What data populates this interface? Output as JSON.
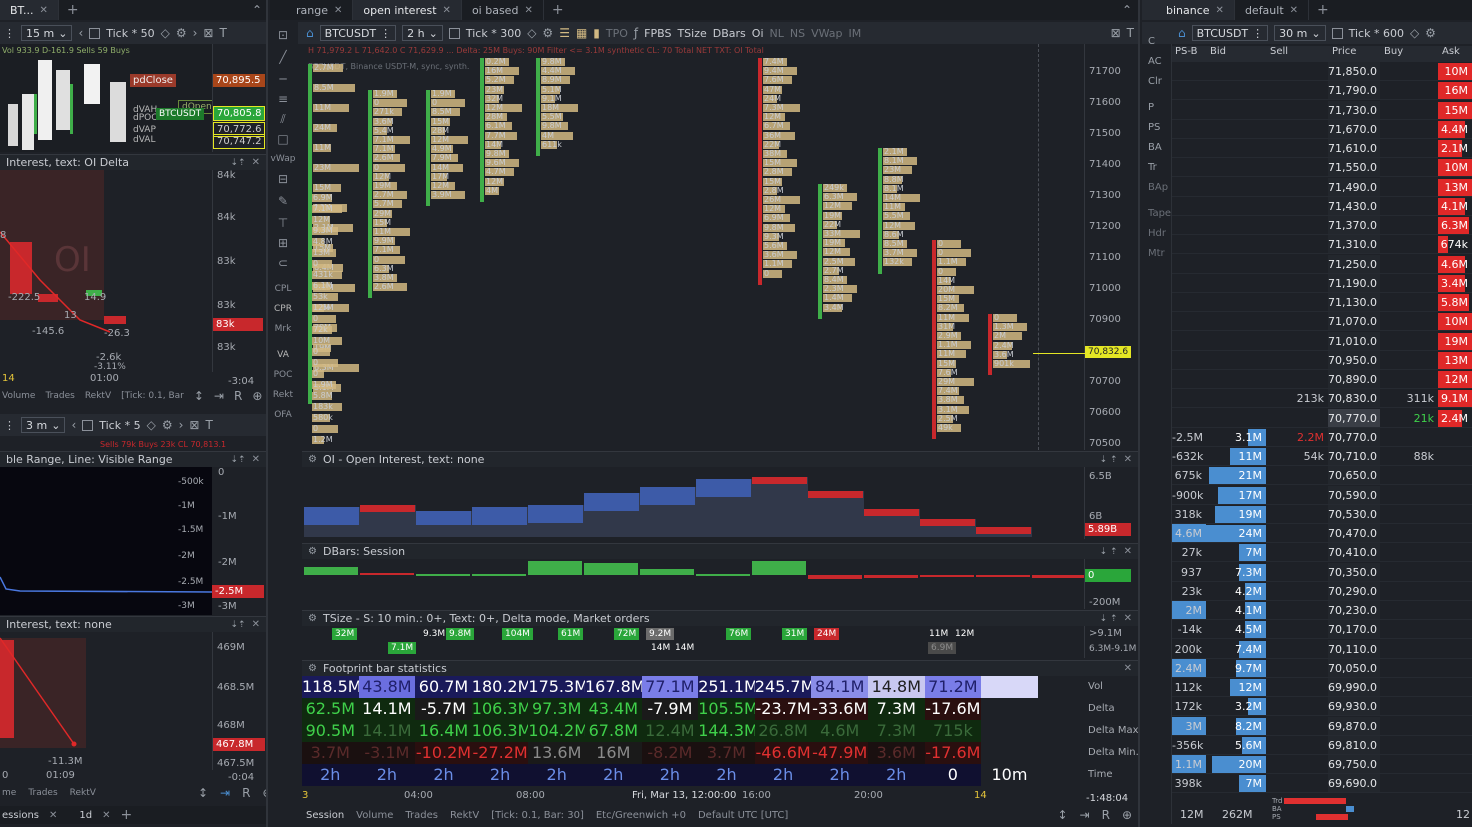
{
  "tabs_left": {
    "first": "BT...",
    "first_close": "✕"
  },
  "tabs_center": [
    {
      "label": "range"
    },
    {
      "label": "open interest"
    },
    {
      "label": "oi based"
    }
  ],
  "tabs_right": [
    {
      "label": "binance"
    },
    {
      "label": "default"
    }
  ],
  "tab_close": "✕",
  "tab_add": "+",
  "left_top": {
    "sym": "⋮",
    "tf": "15 m",
    "tick": "Tick * 50",
    "title": "Interest, text: OI Delta",
    "info": "Vol 933.9 D-161.9 Sells 59 Buys",
    "vlabel_pdclose": "pdClose",
    "price_tag1": "70,895.5",
    "price_tag2": "70,805.8",
    "price_tag3": "70,772.6",
    "price_tag4": "70,747.2",
    "sym_tag": "BTCUSDT",
    "dvah": "dVAH",
    "dpoc": "dPOC",
    "dvap": "dVAP",
    "dval": "dVAL",
    "oopen": "dOpen",
    "axis": [
      "84k",
      "84k",
      "83k",
      "83k",
      "83k"
    ],
    "axis_tag": "83k",
    "vals": [
      "-222.5",
      "14.9",
      "13",
      "-145.6",
      "-26.3",
      "-2.6k",
      "-3.11%"
    ],
    "left_edge": "8",
    "t1": "14",
    "t2": "01:00",
    "t3": "-3:04",
    "bottom": [
      "Volume",
      "Trades",
      "RektV",
      "[Tick: 0.1, Bar"
    ],
    "big": "OI"
  },
  "left_mid": {
    "tf": "3 m",
    "tick": "Tick * 5",
    "title": "ble Range, Line: Visible Range",
    "info": "Sells 79k Buys 23k CL 70,813.1",
    "axis": [
      "0",
      "-500k",
      "-1M",
      "-1M",
      "-1.5M",
      "-2M",
      "-2M",
      "-2.5M",
      "-3M",
      "-3M"
    ],
    "axis_tag": "-2.5M"
  },
  "left_bot": {
    "title": "Interest, text: none",
    "axis": [
      "469M",
      "468.5M",
      "468M",
      "467.5M"
    ],
    "axis_tag": "467.8M",
    "val": "-11.3M",
    "t1": "0",
    "t2": "01:09",
    "t3": "-0:04",
    "bottom": [
      "me",
      "Trades",
      "RektV"
    ],
    "tabs": [
      "essions",
      "1d"
    ]
  },
  "center": {
    "symbol": "BTCUSDT",
    "tf": "2 h",
    "tick": "Tick * 300",
    "tools": [
      "TPO",
      "FPBS",
      "TSize",
      "DBars",
      "Oi",
      "NL",
      "NS",
      "VWap",
      "IM"
    ],
    "info": "H 71,979.2 L 71,642.0 C 71,629.9 ... Delta: 25M Buys: 90M   Filter <= 3.1M synthetic CL: 70 Total NET TXT: OI Total",
    "info2": "BTCUSDT, Binance USDT-M, sync, synth.",
    "yaxis": [
      "71700",
      "71600",
      "71500",
      "71400",
      "71300",
      "71200",
      "71100",
      "71000",
      "70900",
      "70800",
      "70700",
      "70600",
      "70500"
    ],
    "price_tag": "70,832.6",
    "oi_title": "OI - Open Interest, text: none",
    "oi_axis": [
      "6.5B",
      "6B"
    ],
    "oi_tag": "5.89B",
    "dbars_title": "DBars: Session",
    "dbars_axis": [
      "0",
      "-200M"
    ],
    "dbars_tag": "0",
    "tsize_title": "TSize - S: 10 min.: 0+, Text: 0+, Delta mode,  Market orders",
    "tsize_axis": [
      ">9.1M",
      "6.3M-9.1M"
    ],
    "tsize_top": [
      "32M",
      "7.1M",
      "9.3M",
      "9.8M",
      "104M",
      "61M",
      "72M",
      "9.2M",
      "76M",
      "31M",
      "24M",
      "11M",
      "12M"
    ],
    "tsize_bot": [
      "14M",
      "14M",
      "6.9M"
    ],
    "fp_title": "Footprint bar statistics",
    "fp_rows": [
      {
        "label": "Vol",
        "cells": [
          "118.5M",
          "43.8M",
          "60.7M",
          "180.2M",
          "175.3M",
          "167.8M",
          "77.1M",
          "251.1M",
          "245.7M",
          "84.1M",
          "14.8M",
          "71.2M",
          ""
        ]
      },
      {
        "label": "Delta",
        "cells": [
          "62.5M",
          "14.1M",
          "-5.7M",
          "106.3M",
          "97.3M",
          "43.4M",
          "-7.9M",
          "105.5M",
          "-23.7M",
          "-33.6M",
          "7.3M",
          "-17.6M",
          ""
        ]
      },
      {
        "label": "Delta Max.",
        "cells": [
          "90.5M",
          "14.1M",
          "16.4M",
          "106.3M",
          "104.2M",
          "67.8M",
          "12.4M",
          "144.3M",
          "26.8M",
          "4.6M",
          "7.3M",
          "715k",
          ""
        ]
      },
      {
        "label": "Delta Min.",
        "cells": [
          "3.7M",
          "-3.1M",
          "-10.2M",
          "-27.2M",
          "13.6M",
          "16M",
          "-8.2M",
          "3.7M",
          "-46.6M",
          "-47.9M",
          "3.6M",
          "-17.6M",
          ""
        ]
      },
      {
        "label": "Time",
        "cells": [
          "2h",
          "2h",
          "2h",
          "2h",
          "2h",
          "2h",
          "2h",
          "2h",
          "2h",
          "2h",
          "2h",
          "0",
          "10m"
        ]
      }
    ],
    "xaxis": [
      "3",
      "04:00",
      "08:00",
      "Fri, Mar 13, 12:00:00",
      "16:00",
      "20:00",
      "14"
    ],
    "countdown": "-1:48:04",
    "bottom": [
      "Session",
      "Volume",
      "Trades",
      "RektV",
      "[Tick: 0.1, Bar: 30]",
      "Etc/Greenwich +0",
      "Default UTC [UTC]"
    ],
    "bar_labels": [
      [
        "2.7M",
        "8.5M",
        "11M",
        "24M",
        "11M",
        "23M",
        "15M",
        "16M",
        "2.1M",
        "15M",
        "6.4M",
        "1.2M",
        "2.6M",
        "29M",
        "19M",
        "6.3M",
        "3.1M"
      ],
      [
        "1.9M",
        "0",
        "271k",
        "3.6M",
        "5.4M",
        "7.1M",
        "7.1M",
        "2.6M",
        "0",
        "12M",
        "19M",
        "2.7M",
        "5.7M",
        "29M",
        "15M",
        "11M",
        "9.9M",
        "7.1M",
        "0",
        "6.3M",
        "3.8M",
        "2.6M"
      ],
      [
        "1.9M",
        "0",
        "8.5M",
        "15M",
        "28M",
        "12M",
        "4.9M",
        "7.9M",
        "14M",
        "17M",
        "12M",
        "3.9M"
      ],
      [
        "0.2M",
        "16M",
        "5.2M",
        "23M",
        "32M",
        "12M",
        "28M",
        "6.1M",
        "7.7M",
        "14M",
        "9.8M",
        "9.6M",
        "4.7M",
        "12M",
        "4M"
      ],
      [
        "9.8M",
        "4.4M",
        "8.9M",
        "5.1M",
        "9.1M",
        "18M",
        "5.5M",
        "9.8M",
        "4M",
        "611k"
      ],
      [
        "7.4M",
        "9.4M",
        "7.6M",
        "47M",
        "24M",
        "7.3M",
        "12M",
        "6.7M",
        "36M",
        "22M",
        "38M",
        "15M",
        "2.8M",
        "15M",
        "2.8M",
        "26M",
        "12M",
        "6.9M",
        "9.8M",
        "9.3M",
        "5.6M",
        "3.6M",
        "1.1M",
        "0"
      ],
      [
        "249k",
        "6.3M",
        "12M",
        "19M",
        "22M",
        "33M",
        "19M",
        "12M",
        "2.5M",
        "2.7M",
        "8.4M",
        "2.3M",
        "1.4M",
        "3.4M"
      ],
      [
        "2.1M",
        "8.1M",
        "23M",
        "8.8M",
        "8.1M",
        "14M",
        "11M",
        "5.5M",
        "12M",
        "8.6M",
        "8.5M",
        "3.7M",
        "132k"
      ],
      [
        "0",
        "0",
        "1.1M",
        "0",
        "14M",
        "20M",
        "15M",
        "8.2M",
        "11M",
        "31M",
        "2.9M",
        "1.1M",
        "11M",
        "15M",
        "7.6M",
        "29M",
        "7.4M",
        "3.8M",
        "3.1M",
        "2.5M",
        "49k"
      ],
      [
        "0",
        "1.3M",
        "2M",
        "2.4M",
        "3.6M",
        "901k"
      ]
    ]
  },
  "right": {
    "symbol": "BTCUSDT",
    "tf": "30 m",
    "tick": "Tick * 600",
    "side": [
      "C",
      "AC",
      "Clr",
      "P",
      "PS",
      "BA",
      "Tr",
      "BAp",
      "Tape",
      "Hdr",
      "Mtr"
    ],
    "headers": [
      "PS-B",
      "Bid",
      "Sell",
      "Price",
      "Buy",
      "Ask"
    ],
    "rows": [
      {
        "ps": "",
        "bid": "",
        "sell": "",
        "price": "71,850.0",
        "buy": "",
        "ask": "10M",
        "ab": 1,
        "bb": 0
      },
      {
        "ps": "",
        "bid": "",
        "sell": "",
        "price": "71,790.0",
        "buy": "",
        "ask": "16M",
        "ab": 1,
        "bb": 0
      },
      {
        "ps": "",
        "bid": "",
        "sell": "",
        "price": "71,730.0",
        "buy": "",
        "ask": "15M",
        "ab": 1,
        "bb": 0
      },
      {
        "ps": "",
        "bid": "",
        "sell": "",
        "price": "71,670.0",
        "buy": "",
        "ask": "4.4M",
        "ab": 0.8,
        "bb": 0
      },
      {
        "ps": "",
        "bid": "",
        "sell": "",
        "price": "71,610.0",
        "buy": "",
        "ask": "2.1M",
        "ab": 0.7,
        "bb": 0
      },
      {
        "ps": "",
        "bid": "",
        "sell": "",
        "price": "71,550.0",
        "buy": "",
        "ask": "10M",
        "ab": 1,
        "bb": 0
      },
      {
        "ps": "",
        "bid": "",
        "sell": "",
        "price": "71,490.0",
        "buy": "",
        "ask": "13M",
        "ab": 1,
        "bb": 0
      },
      {
        "ps": "",
        "bid": "",
        "sell": "",
        "price": "71,430.0",
        "buy": "",
        "ask": "4.1M",
        "ab": 0.8,
        "bb": 0
      },
      {
        "ps": "",
        "bid": "",
        "sell": "",
        "price": "71,370.0",
        "buy": "",
        "ask": "6.3M",
        "ab": 0.9,
        "bb": 0
      },
      {
        "ps": "",
        "bid": "",
        "sell": "",
        "price": "71,310.0",
        "buy": "",
        "ask": "674k",
        "ab": 0.3,
        "bb": 0
      },
      {
        "ps": "",
        "bid": "",
        "sell": "",
        "price": "71,250.0",
        "buy": "",
        "ask": "4.6M",
        "ab": 0.8,
        "bb": 0
      },
      {
        "ps": "",
        "bid": "",
        "sell": "",
        "price": "71,190.0",
        "buy": "",
        "ask": "3.4M",
        "ab": 0.8,
        "bb": 0
      },
      {
        "ps": "",
        "bid": "",
        "sell": "",
        "price": "71,130.0",
        "buy": "",
        "ask": "5.8M",
        "ab": 0.9,
        "bb": 0
      },
      {
        "ps": "",
        "bid": "",
        "sell": "",
        "price": "71,070.0",
        "buy": "",
        "ask": "10M",
        "ab": 1,
        "bb": 0
      },
      {
        "ps": "",
        "bid": "",
        "sell": "",
        "price": "71,010.0",
        "buy": "",
        "ask": "19M",
        "ab": 1,
        "bb": 0
      },
      {
        "ps": "",
        "bid": "",
        "sell": "",
        "price": "70,950.0",
        "buy": "",
        "ask": "13M",
        "ab": 1,
        "bb": 0
      },
      {
        "ps": "",
        "bid": "",
        "sell": "",
        "price": "70,890.0",
        "buy": "",
        "ask": "12M",
        "ab": 1,
        "bb": 0
      },
      {
        "ps": "",
        "bid": "",
        "sell": "213k",
        "price": "70,830.0",
        "buy": "311k",
        "ask": "9.1M",
        "ab": 1,
        "bb": 0
      },
      {
        "ps": "",
        "bid": "",
        "sell": "",
        "price": "70,770.0",
        "buy": "21k",
        "ask": "2.4M",
        "ab": 0.7,
        "bb": 0,
        "hl": 1
      },
      {
        "ps": "-2.5M",
        "bid": "3.1M",
        "sell": "2.2M",
        "price": "70,770.0",
        "buy": "",
        "ask": "",
        "ab": 0,
        "bb": 0.3
      },
      {
        "ps": "-632k",
        "bid": "11M",
        "sell": "54k",
        "price": "70,710.0",
        "buy": "88k",
        "ask": "",
        "ab": 0,
        "bb": 0.6
      },
      {
        "ps": "675k",
        "bid": "21M",
        "sell": "",
        "price": "70,650.0",
        "buy": "",
        "ask": "",
        "ab": 0,
        "bb": 0.95
      },
      {
        "ps": "-900k",
        "bid": "17M",
        "sell": "",
        "price": "70,590.0",
        "buy": "",
        "ask": "",
        "ab": 0,
        "bb": 0.8
      },
      {
        "ps": "318k",
        "bid": "19M",
        "sell": "",
        "price": "70,530.0",
        "buy": "",
        "ask": "",
        "ab": 0,
        "bb": 0.85
      },
      {
        "ps": "4.6M",
        "bid": "24M",
        "sell": "",
        "price": "70,470.0",
        "buy": "",
        "ask": "",
        "ab": 0,
        "bb": 1,
        "pshl": 1
      },
      {
        "ps": "27k",
        "bid": "7M",
        "sell": "",
        "price": "70,410.0",
        "buy": "",
        "ask": "",
        "ab": 0,
        "bb": 0.45
      },
      {
        "ps": "937",
        "bid": "7.3M",
        "sell": "",
        "price": "70,350.0",
        "buy": "",
        "ask": "",
        "ab": 0,
        "bb": 0.45
      },
      {
        "ps": "23k",
        "bid": "4.2M",
        "sell": "",
        "price": "70,290.0",
        "buy": "",
        "ask": "",
        "ab": 0,
        "bb": 0.35
      },
      {
        "ps": "2M",
        "bid": "4.1M",
        "sell": "",
        "price": "70,230.0",
        "buy": "",
        "ask": "",
        "ab": 0,
        "bb": 0.35,
        "pshl": 1
      },
      {
        "ps": "-14k",
        "bid": "4.5M",
        "sell": "",
        "price": "70,170.0",
        "buy": "",
        "ask": "",
        "ab": 0,
        "bb": 0.35
      },
      {
        "ps": "200k",
        "bid": "7.4M",
        "sell": "",
        "price": "70,110.0",
        "buy": "",
        "ask": "",
        "ab": 0,
        "bb": 0.45
      },
      {
        "ps": "2.4M",
        "bid": "9.7M",
        "sell": "",
        "price": "70,050.0",
        "buy": "",
        "ask": "",
        "ab": 0,
        "bb": 0.5,
        "pshl": 1
      },
      {
        "ps": "112k",
        "bid": "12M",
        "sell": "",
        "price": "69,990.0",
        "buy": "",
        "ask": "",
        "ab": 0,
        "bb": 0.6
      },
      {
        "ps": "172k",
        "bid": "3.2M",
        "sell": "",
        "price": "69,930.0",
        "buy": "",
        "ask": "",
        "ab": 0,
        "bb": 0.3
      },
      {
        "ps": "3M",
        "bid": "8.2M",
        "sell": "",
        "price": "69,870.0",
        "buy": "",
        "ask": "",
        "ab": 0,
        "bb": 0.5,
        "pshl": 1
      },
      {
        "ps": "-356k",
        "bid": "5.6M",
        "sell": "",
        "price": "69,810.0",
        "buy": "",
        "ask": "",
        "ab": 0,
        "bb": 0.4
      },
      {
        "ps": "1.1M",
        "bid": "20M",
        "sell": "",
        "price": "69,750.0",
        "buy": "",
        "ask": "",
        "ab": 0,
        "bb": 0.9,
        "pshl": 1
      },
      {
        "ps": "398k",
        "bid": "7M",
        "sell": "",
        "price": "69,690.0",
        "buy": "",
        "ask": "",
        "ab": 0,
        "bb": 0.45
      }
    ],
    "footer": {
      "ps": "12M",
      "bid": "262M",
      "labels": [
        "Trd",
        "BA",
        "PS"
      ],
      "right": "12"
    }
  },
  "colors": {
    "bg": "#1e2127",
    "green": "#3fae49",
    "red": "#c8282c",
    "tan": "#d2b983",
    "blue": "#4a8ed0",
    "yellow": "#e4e624",
    "purple": "#6b6ee0"
  }
}
